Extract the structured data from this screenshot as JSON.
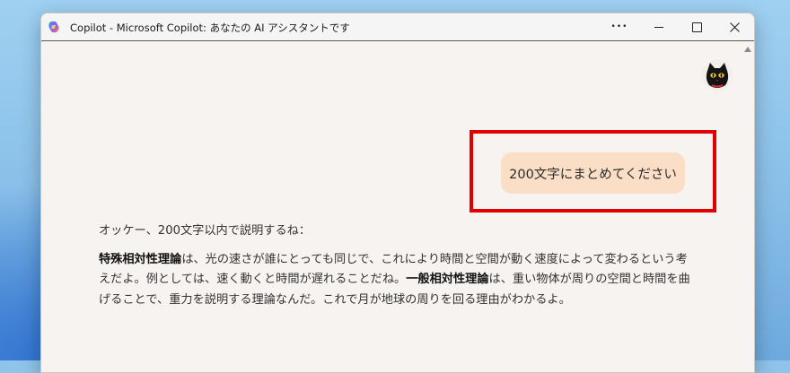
{
  "window": {
    "title": "Copilot - Microsoft Copilot: あなたの AI アシスタントです",
    "controls": {
      "more": "•••",
      "maximize": "☐",
      "close": "✕"
    }
  },
  "icons": {
    "app": "copilot-logo-icon",
    "more": "ellipsis-icon",
    "maximize": "maximize-icon",
    "close": "close-icon",
    "avatar": "black-cat-avatar",
    "scroll_up": "scroll-up-arrow-icon"
  },
  "colors": {
    "user_bubble": "#fbdec6",
    "highlight": "#e00000",
    "page_background": "#f7f3f0"
  },
  "chat": {
    "user_message": "200文字にまとめてください",
    "reply_intro": "オッケー、200文字以内で説明するね：",
    "reply_parts": {
      "t1": "特殊相対性理論",
      "t2": "は、光の速さが誰にとっても同じで、これにより時間と空間が動く速度によって変わるという考えだよ。例としては、速く動くと時間が遅れることだね。",
      "t3": "一般相対性理論",
      "t4": "は、重い物体が周りの空間と時間を曲げることで、重力を説明する理論なんだ。これで月が地球の周りを回る理由がわかるよ。"
    }
  }
}
